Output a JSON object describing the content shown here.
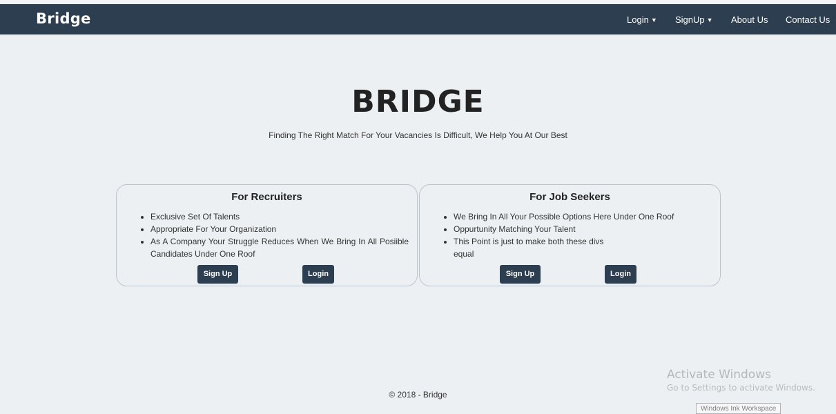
{
  "navbar": {
    "brand": "Bridge",
    "items": [
      {
        "label": "Login",
        "dropdown": true
      },
      {
        "label": "SignUp",
        "dropdown": true
      },
      {
        "label": "About Us",
        "dropdown": false
      },
      {
        "label": "Contact Us",
        "dropdown": false
      }
    ],
    "caret_icon": "caret-down-icon",
    "colors": {
      "navbar_bg": "#2c3e50",
      "page_bg": "#edf0f2"
    }
  },
  "hero": {
    "title": "BRIDGE",
    "subtitle": "Finding The Right Match For Your Vacancies Is Difficult, We Help You At Our Best"
  },
  "cards": [
    {
      "title": "For Recruiters",
      "points": [
        "Exclusive Set Of Talents",
        "Appropriate For Your Organization",
        "As A Company Your Struggle Reduces When We Bring In All Posiible Candidates Under One Roof"
      ],
      "signup_label": "Sign Up",
      "login_label": "Login"
    },
    {
      "title": "For Job Seekers",
      "points": [
        "We Bring In All Your Possible Options Here Under One Roof",
        "Oppurtunity Matching Your Talent",
        "This Point is just to make both these divs equal"
      ],
      "signup_label": "Sign Up",
      "login_label": "Login"
    }
  ],
  "footer": {
    "text": "© 2018 - Bridge"
  },
  "overlay": {
    "activate_title": "Activate Windows",
    "activate_sub": "Go to Settings to activate Windows.",
    "ink_workspace": "Windows Ink Workspace"
  }
}
